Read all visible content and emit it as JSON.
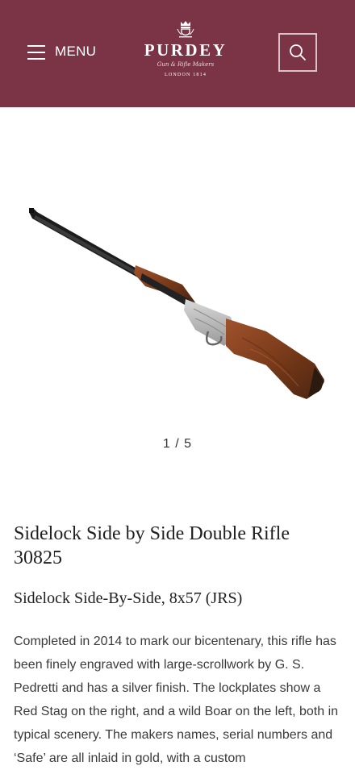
{
  "header": {
    "menu_label": "MENU",
    "brand": "PURDEY",
    "tagline": "Gun & Rifle Makers",
    "place": "LONDON 1814",
    "background": "#7b3446"
  },
  "gallery": {
    "counter": "1 / 5",
    "image_icon": "rifle-image"
  },
  "product": {
    "title": "Sidelock Side by Side Double Rifle 30825",
    "subtitle": "Sidelock Side-By-Side, 8x57 (JRS)",
    "description": "Completed in 2014 to mark our bicentenary, this rifle has been finely engraved with large-scrollwork by G. S. Pedretti and has a silver finish. The lockplates show a Red Stag on the right, and a wild Boar on the left, both in typical scenery. The makers names, serial numbers and ‘Safe’ are all inlaid in gold, with a custom"
  }
}
